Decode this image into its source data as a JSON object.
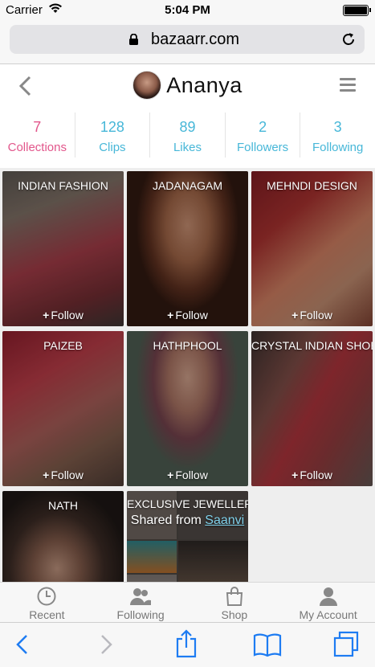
{
  "status_bar": {
    "carrier": "Carrier",
    "time": "5:04 PM"
  },
  "browser": {
    "url": "bazaarr.com"
  },
  "header": {
    "profile_name": "Ananya"
  },
  "stats": [
    {
      "value": "7",
      "label": "Collections",
      "active": true
    },
    {
      "value": "128",
      "label": "Clips"
    },
    {
      "value": "89",
      "label": "Likes"
    },
    {
      "value": "2",
      "label": "Followers"
    },
    {
      "value": "3",
      "label": "Following"
    }
  ],
  "collections": [
    {
      "title": "INDIAN FASHION",
      "follow": "Follow"
    },
    {
      "title": "JADANAGAM",
      "follow": "Follow"
    },
    {
      "title": "MEHNDI DESIGN",
      "follow": "Follow"
    },
    {
      "title": "PAIZEB",
      "follow": "Follow"
    },
    {
      "title": "HATHPHOOL",
      "follow": "Follow"
    },
    {
      "title": "CRYSTAL INDIAN SHOES",
      "follow": "Follow"
    },
    {
      "title": "NATH"
    },
    {
      "title": "EXCLUSIVE JEWELLERY",
      "shared_prefix": "Shared from",
      "shared_user": "Saanvi"
    }
  ],
  "tabs": [
    {
      "label": "Recent",
      "icon": "clock-icon"
    },
    {
      "label": "Following",
      "icon": "people-icon"
    },
    {
      "label": "Shop",
      "icon": "shopping-bag-icon"
    },
    {
      "label": "My Account",
      "icon": "person-icon"
    }
  ],
  "colors": {
    "accent_pink": "#e2568b",
    "accent_blue": "#47b7d8",
    "ios_blue": "#1e7cf2"
  }
}
